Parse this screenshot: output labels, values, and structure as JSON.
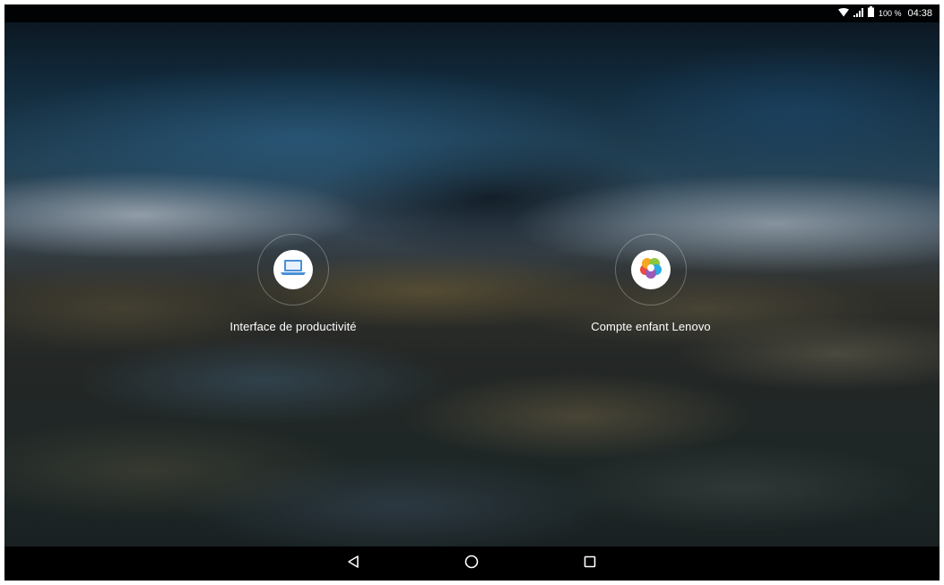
{
  "status_bar": {
    "battery_percent": "100 %",
    "time": "04:38",
    "icons": [
      "wifi-icon",
      "cell-signal-icon",
      "battery-icon"
    ]
  },
  "launcher_choices": [
    {
      "label": "Interface de productivité",
      "icon": "laptop-icon"
    },
    {
      "label": "Compte enfant Lenovo",
      "icon": "kids-account-logo-icon"
    }
  ],
  "navigation_bar": {
    "buttons": [
      "back-button",
      "home-button",
      "recents-button"
    ]
  },
  "colors": {
    "status_bar": "#000000",
    "nav_bar": "#000000",
    "laptop_blue": "#4a90d9",
    "label_text": "#ffffff"
  }
}
